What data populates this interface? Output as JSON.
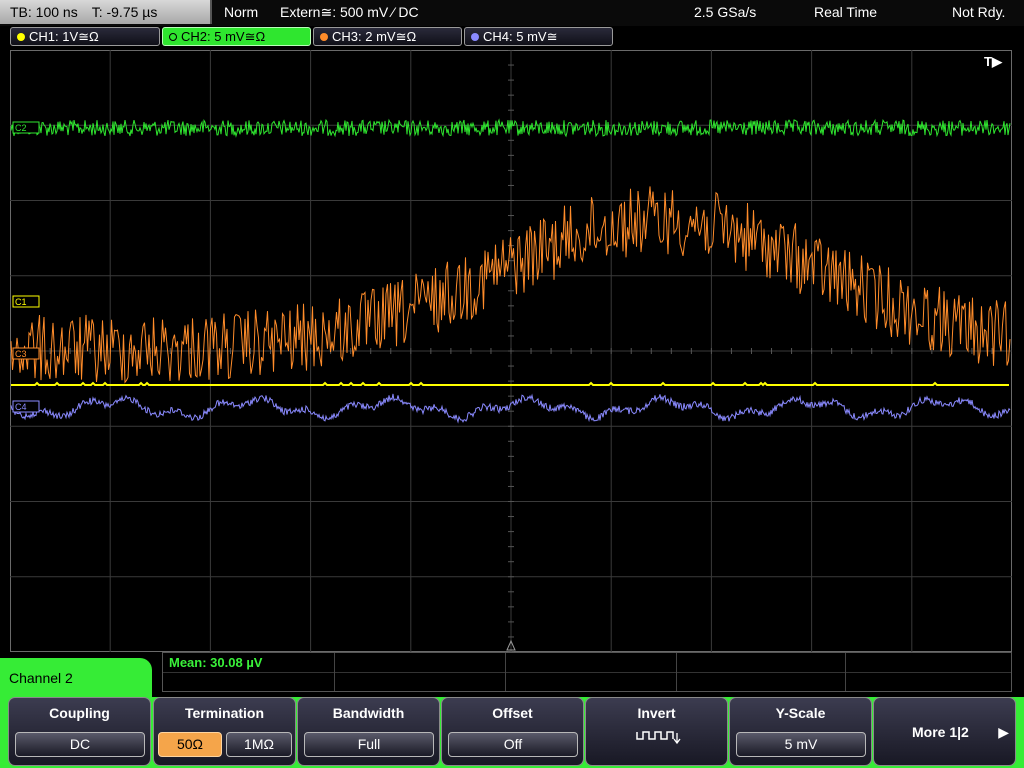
{
  "top_bar": {
    "timebase": "TB: 100 ns",
    "trigger_time": "T: -9.75 µs",
    "trigger_mode": "Norm",
    "trigger_source": "Extern≅: 500 mV ⁄ DC",
    "sample_rate": "2.5 GSa/s",
    "acq_mode": "Real Time",
    "status": "Not Rdy."
  },
  "channels": [
    {
      "label": "CH1: 1V≅Ω",
      "color": "#ffff00",
      "marker": "C1"
    },
    {
      "label": "CH2: 5 mV≅Ω",
      "color": "#2fe62f",
      "marker": "C2"
    },
    {
      "label": "CH3: 2 mV≅Ω",
      "color": "#ff8c2a",
      "marker": "C3"
    },
    {
      "label": "CH4: 5 mV≅",
      "color": "#8a8aff",
      "marker": "C4"
    }
  ],
  "trigger_marker": "T▶",
  "measurement": {
    "mean": "Mean: 30.08 µV"
  },
  "menu": {
    "title": "Channel 2",
    "coupling": {
      "title": "Coupling",
      "value": "DC"
    },
    "termination": {
      "title": "Termination",
      "opt1": "50Ω",
      "opt2": "1MΩ"
    },
    "bandwidth": {
      "title": "Bandwidth",
      "value": "Full"
    },
    "offset": {
      "title": "Offset",
      "value": "Off"
    },
    "invert": {
      "title": "Invert",
      "icon": "invert-waveform-icon"
    },
    "yscale": {
      "title": "Y-Scale",
      "value": "5 mV"
    },
    "more": {
      "label": "More 1|2",
      "icon": "arrow-right-icon"
    }
  }
}
